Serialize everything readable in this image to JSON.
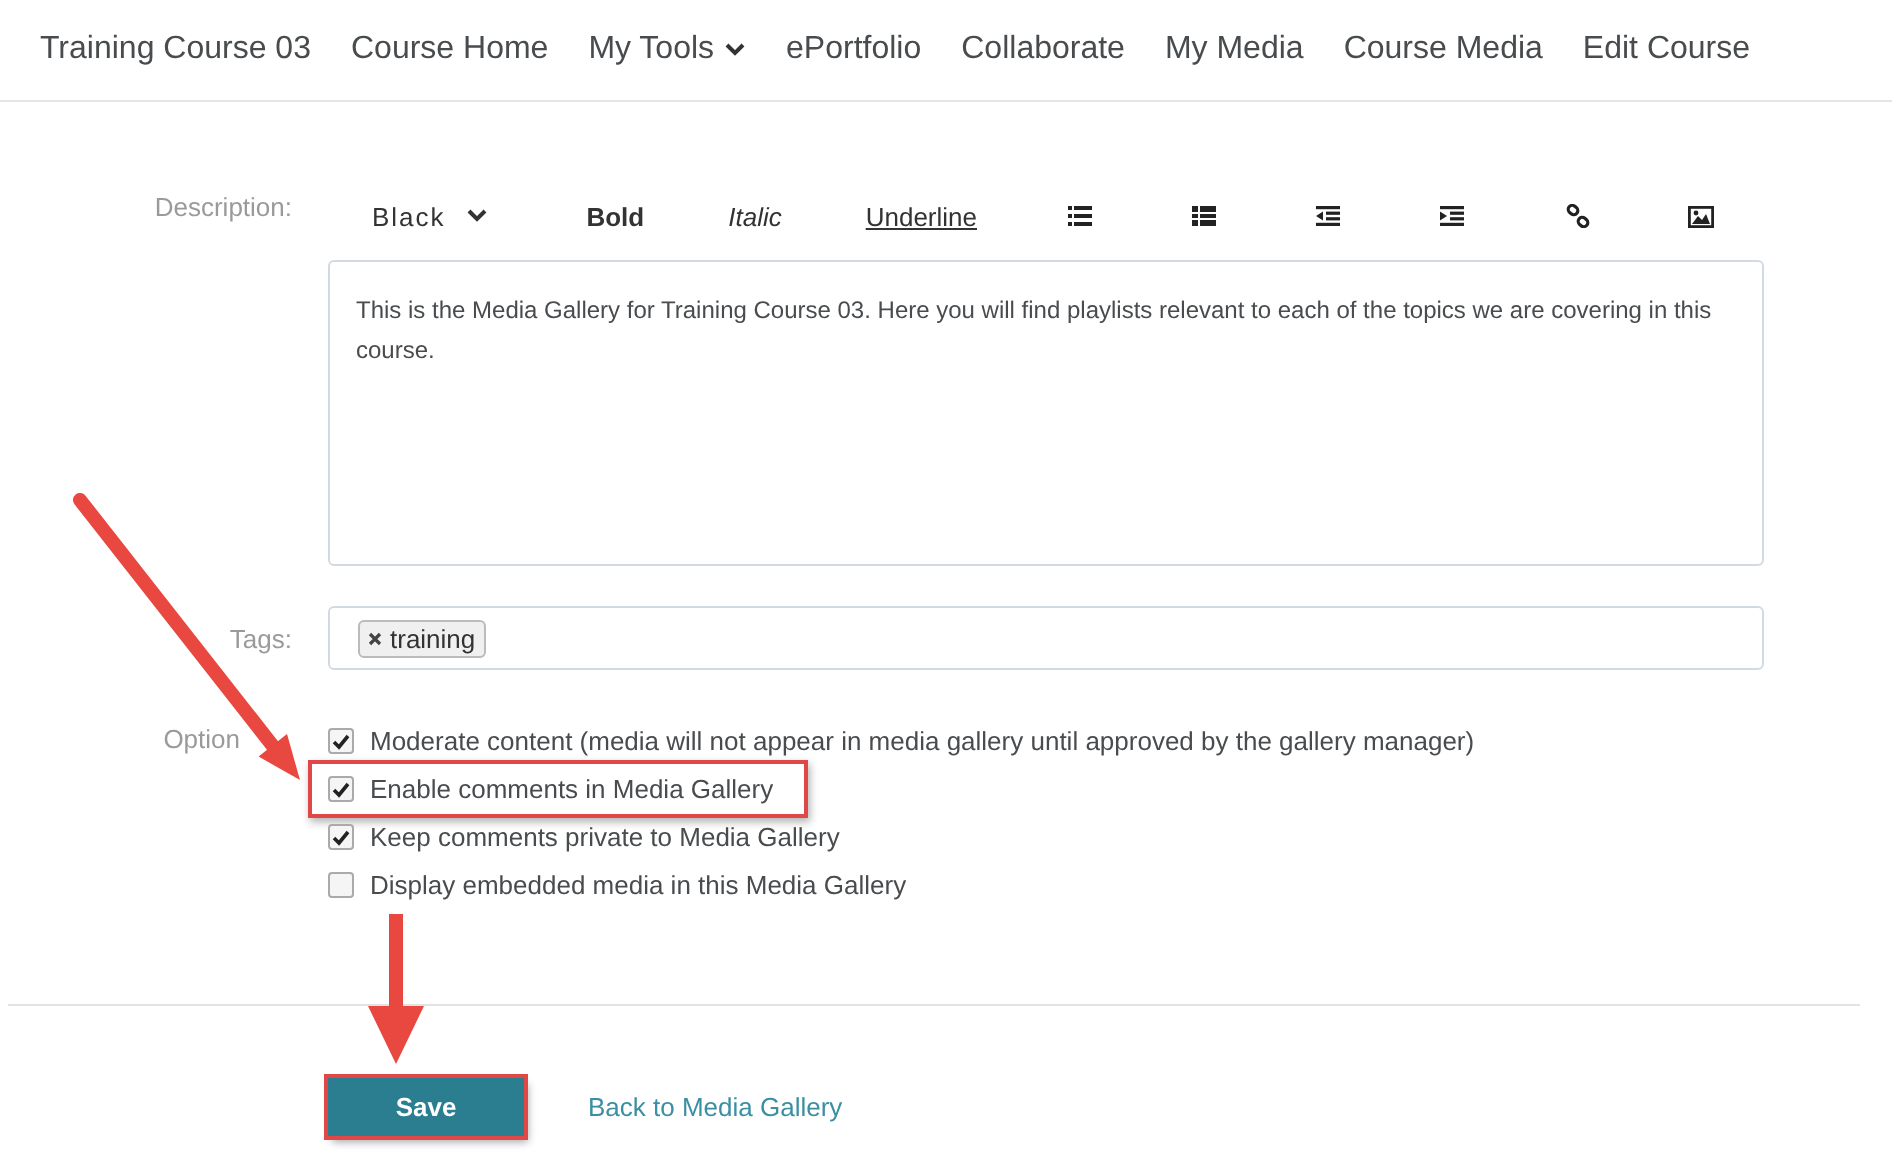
{
  "nav": [
    {
      "label": "Training Course 03",
      "dropdown": false
    },
    {
      "label": "Course Home",
      "dropdown": false
    },
    {
      "label": "My Tools",
      "dropdown": true
    },
    {
      "label": "ePortfolio",
      "dropdown": false
    },
    {
      "label": "Collaborate",
      "dropdown": false
    },
    {
      "label": "My Media",
      "dropdown": false
    },
    {
      "label": "Course Media",
      "dropdown": false
    },
    {
      "label": "Edit Course",
      "dropdown": false
    }
  ],
  "description": {
    "label": "Description:",
    "toolbar": [
      {
        "kind": "font",
        "label": "Black"
      },
      {
        "kind": "bold",
        "label": "Bold"
      },
      {
        "kind": "italic",
        "label": "Italic"
      },
      {
        "kind": "underline",
        "label": "Underline"
      },
      {
        "kind": "bullet-list"
      },
      {
        "kind": "numbered-list"
      },
      {
        "kind": "outdent"
      },
      {
        "kind": "indent"
      },
      {
        "kind": "link"
      },
      {
        "kind": "image"
      }
    ],
    "value": "This is the Media Gallery for Training Course 03.  Here you will find playlists relevant to each of the topics we are covering in this course."
  },
  "tags": {
    "label": "Tags:",
    "items": [
      "training"
    ]
  },
  "options": {
    "label": "Option",
    "items": [
      {
        "label": "Moderate content (media will not appear in media gallery until approved by the gallery manager)",
        "checked": true,
        "highlighted": false
      },
      {
        "label": "Enable comments in Media Gallery",
        "checked": true,
        "highlighted": true
      },
      {
        "label": "Keep comments private to Media Gallery",
        "checked": true,
        "highlighted": false
      },
      {
        "label": "Display embedded media in this Media Gallery",
        "checked": false,
        "highlighted": false
      }
    ]
  },
  "save": {
    "label": "Save",
    "highlighted": true
  },
  "back_link": "Back to Media Gallery"
}
